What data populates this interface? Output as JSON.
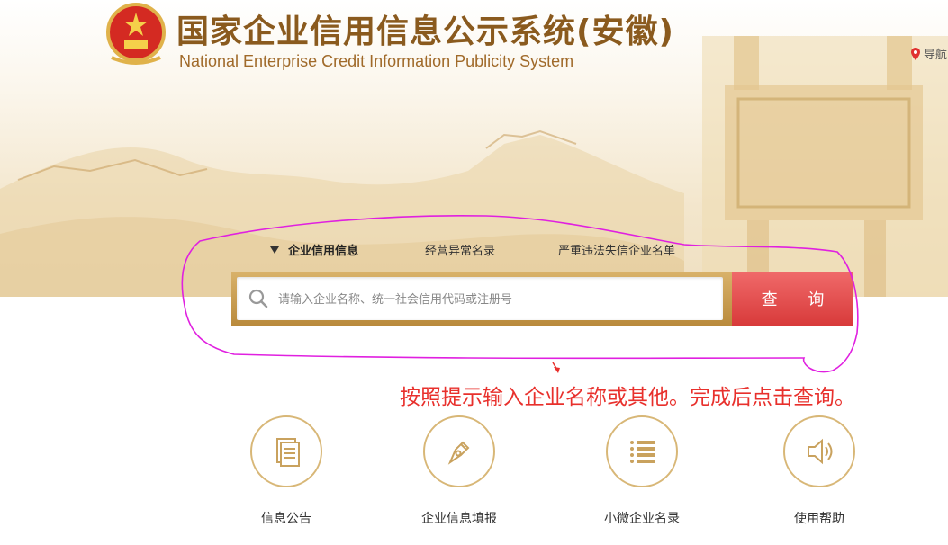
{
  "header": {
    "title": "国家企业信用信息公示系统(安徽)",
    "subtitle": "National Enterprise Credit Information Publicity System",
    "nav_label": "导航"
  },
  "search": {
    "tabs": [
      {
        "label": "企业信用信息",
        "active": true
      },
      {
        "label": "经营异常名录",
        "active": false
      },
      {
        "label": "严重违法失信企业名单",
        "active": false
      }
    ],
    "placeholder": "请输入企业名称、统一社会信用代码或注册号",
    "value": "",
    "button_label": "查 询"
  },
  "annotation": {
    "text": "按照提示输入企业名称或其他。完成后点击查询。"
  },
  "quick_links": [
    {
      "label": "信息公告",
      "icon": "document-icon"
    },
    {
      "label": "企业信息填报",
      "icon": "pen-nib-icon"
    },
    {
      "label": "小微企业名录",
      "icon": "list-icon"
    },
    {
      "label": "使用帮助",
      "icon": "speaker-icon"
    }
  ],
  "colors": {
    "title_brown": "#8a5a1e",
    "gold": "#d8b777",
    "search_red": "#e04848",
    "annotation_red": "#e8302c",
    "annotation_magenta": "#e020e0"
  }
}
